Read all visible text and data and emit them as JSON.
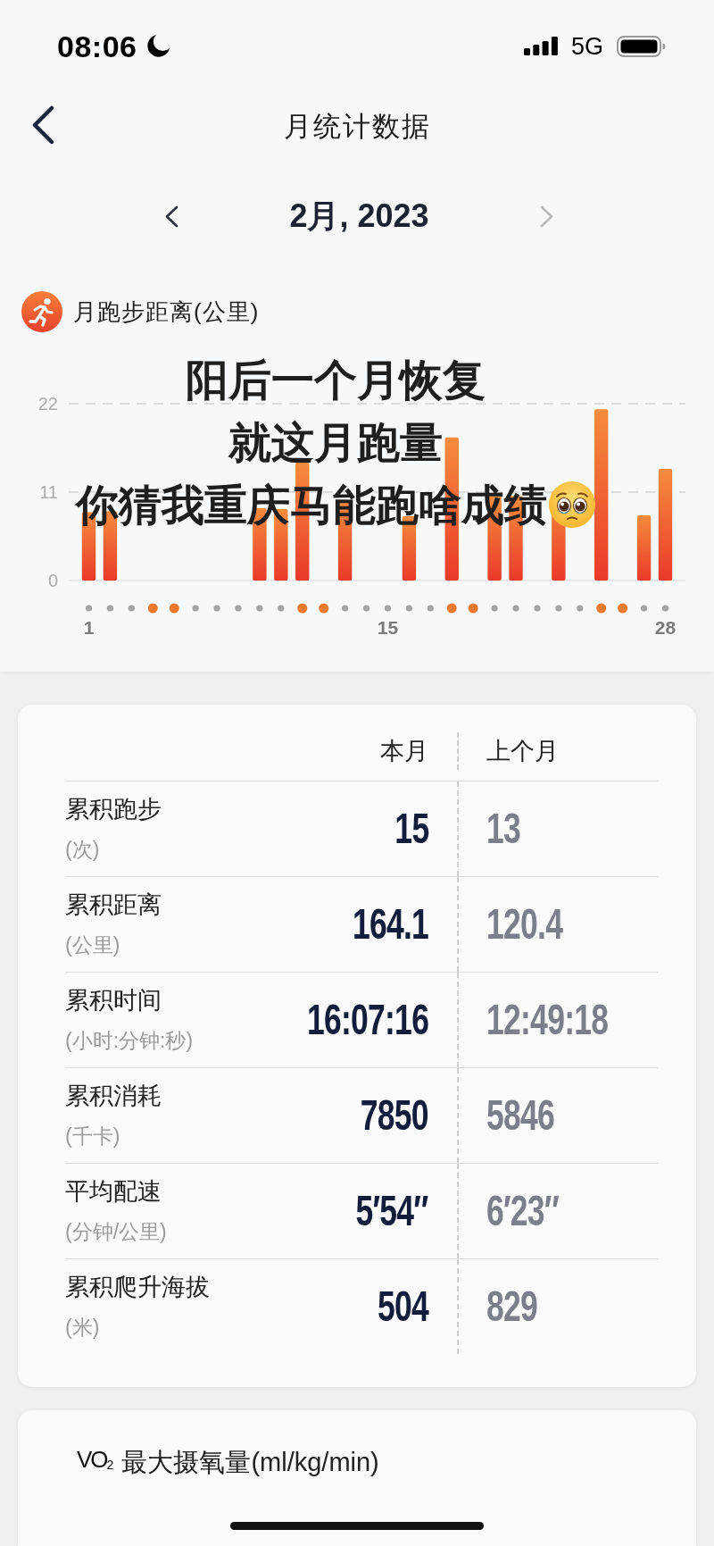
{
  "status_bar": {
    "time": "08:06",
    "network": "5G"
  },
  "nav": {
    "title": "月统计数据"
  },
  "month_picker": {
    "label": "2月, 2023",
    "next_disabled": true
  },
  "chart": {
    "chart_data": {
      "type": "bar",
      "title": "月跑步距离(公里)",
      "x": [
        1,
        2,
        3,
        4,
        5,
        6,
        7,
        8,
        9,
        10,
        11,
        12,
        13,
        14,
        15,
        16,
        17,
        18,
        19,
        20,
        21,
        22,
        23,
        24,
        25,
        26,
        27,
        28
      ],
      "values": [
        8.5,
        8.6,
        null,
        null,
        null,
        null,
        null,
        null,
        9.0,
        8.9,
        14.7,
        null,
        10.0,
        null,
        null,
        8.0,
        null,
        17.8,
        null,
        10.5,
        10.5,
        null,
        11.1,
        null,
        21.3,
        null,
        8.1,
        13.9
      ],
      "xlim": [
        0.06,
        28.94
      ],
      "xticks": [
        1,
        15,
        28
      ],
      "yticks": [
        0,
        11,
        22
      ],
      "ylim": [
        0,
        22
      ]
    },
    "day_markers": [
      {
        "kind": "weekday",
        "color": "#a3a3a3"
      },
      {
        "kind": "weekday",
        "color": "#a3a3a3"
      },
      {
        "kind": "weekday",
        "color": "#a3a3a3"
      },
      {
        "kind": "weekend",
        "color": "#eb7a2e"
      },
      {
        "kind": "weekend",
        "color": "#eb7a2e"
      },
      {
        "kind": "weekday",
        "color": "#a3a3a3"
      },
      {
        "kind": "weekday",
        "color": "#a3a3a3"
      },
      {
        "kind": "weekday",
        "color": "#a3a3a3"
      },
      {
        "kind": "weekday",
        "color": "#a3a3a3"
      },
      {
        "kind": "weekday",
        "color": "#a3a3a3"
      },
      {
        "kind": "weekend",
        "color": "#eb7a2e"
      },
      {
        "kind": "weekend",
        "color": "#eb7a2e"
      },
      {
        "kind": "weekday",
        "color": "#a3a3a3"
      },
      {
        "kind": "weekday",
        "color": "#a3a3a3"
      },
      {
        "kind": "weekday",
        "color": "#a3a3a3"
      },
      {
        "kind": "weekday",
        "color": "#a3a3a3"
      },
      {
        "kind": "weekday",
        "color": "#a3a3a3"
      },
      {
        "kind": "weekend",
        "color": "#eb7a2e"
      },
      {
        "kind": "weekend",
        "color": "#eb7a2e"
      },
      {
        "kind": "weekday",
        "color": "#a3a3a3"
      },
      {
        "kind": "weekday",
        "color": "#a3a3a3"
      },
      {
        "kind": "weekday",
        "color": "#a3a3a3"
      },
      {
        "kind": "weekday",
        "color": "#a3a3a3"
      },
      {
        "kind": "weekday",
        "color": "#a3a3a3"
      },
      {
        "kind": "weekend",
        "color": "#eb7a2e"
      },
      {
        "kind": "weekend",
        "color": "#eb7a2e"
      },
      {
        "kind": "weekday",
        "color": "#a3a3a3"
      },
      {
        "kind": "weekday",
        "color": "#a3a3a3"
      }
    ]
  },
  "caption": [
    "阳后一个月恢复",
    "就这月跑量",
    "你猜我重庆马能跑啥成绩"
  ],
  "stats_table": {
    "columns": [
      "本月",
      "上个月"
    ],
    "rows": [
      {
        "label": "累积跑步",
        "unit": "(次)",
        "this_month": "15",
        "last_month": "13"
      },
      {
        "label": "累积距离",
        "unit": "(公里)",
        "this_month": "164.1",
        "last_month": "120.4"
      },
      {
        "label": "累积时间",
        "unit": "(小时:分钟:秒)",
        "this_month": "16:07:16",
        "last_month": "12:49:18"
      },
      {
        "label": "累积消耗",
        "unit": "(千卡)",
        "this_month": "7850",
        "last_month": "5846"
      },
      {
        "label": "平均配速",
        "unit": "(分钟/公里)",
        "this_month": "5′54″",
        "last_month": "6′23″"
      },
      {
        "label": "累积爬升海拔",
        "unit": "(米)",
        "this_month": "504",
        "last_month": "829"
      }
    ]
  },
  "vo2_card": {
    "symbol": "VO$_{2}$",
    "title": "最大摄氧量(ml/kg/min)"
  }
}
